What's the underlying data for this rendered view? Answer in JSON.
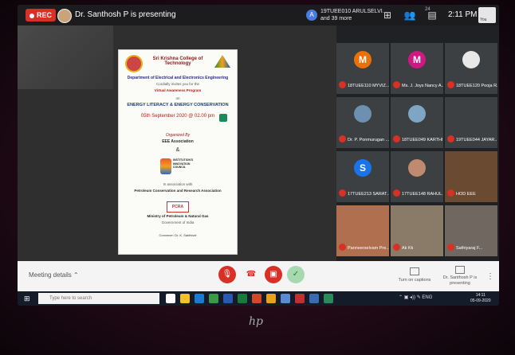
{
  "topbar": {
    "rec_label": "REC",
    "presenter_text": "Dr. Santhosh P is presenting",
    "join_initial": "A",
    "join_line1": "19TUEE010 ARULSELVI...",
    "join_line2": "and 39 more",
    "participant_count": "24",
    "time": "2:11 PM",
    "self_label": "You"
  },
  "presentation": {
    "college": "Sri Krishna College of Technology",
    "dept": "Department of Electrical and Electronics Engineering",
    "invite": "Cordially invites you for the",
    "program": "Virtual Awareness Program",
    "on": "on",
    "title": "ENERGY LITERACY & ENERGY CONSERVATION",
    "date": "05th September 2020 @ 02.00 pm",
    "org": "Organized By",
    "assoc": "EEE Association",
    "amp": "&",
    "iic": "INSTITUTION'S INNOVATION COUNCIL",
    "assoc_with": "In association with",
    "pcra_full": "Petroleum Conservation and Research Association",
    "pcra": "PCRA",
    "ministry": "Ministry of Petroleum & Natural Gas",
    "govt": "Government of India",
    "convener": "Convener: Dr. K. Sakthivel"
  },
  "participants": [
    {
      "initial": "M",
      "name": "18TUEE110 MYVIZ...",
      "color": "#e8710a"
    },
    {
      "initial": "M",
      "name": "Ms. J. Joys Nancy A...",
      "color": "#d01884"
    },
    {
      "initial": "",
      "name": "18TUEE120 Pooja R...",
      "color": "#e8e8e8"
    },
    {
      "initial": "",
      "name": "Dr. P. Ponmurugan ...",
      "color": "#6d8fb0"
    },
    {
      "initial": "",
      "name": "18TUEE049 KARTHI...",
      "color": "#7ea6c4"
    },
    {
      "initial": "",
      "name": "19TUEE044 JAYAR...",
      "color": "#3c4043"
    },
    {
      "initial": "S",
      "name": "17TUEE213 SARAT...",
      "color": "#1a73e8"
    },
    {
      "initial": "",
      "name": "17TUEE148 RAHUL...",
      "color": "#c08a70"
    },
    {
      "initial": "",
      "name": "HOD EEE",
      "color": "#6a4a30"
    },
    {
      "initial": "",
      "name": "Panneerselvam Pre...",
      "color": "#b07050"
    },
    {
      "initial": "",
      "name": "Ak Kk",
      "color": "#8a7a68"
    },
    {
      "initial": "",
      "name": "Sathiyaraj F...",
      "color": "#706860"
    }
  ],
  "controls": {
    "meeting_details": "Meeting details",
    "captions": "Turn on captions",
    "presenting": "Dr. Santhosh P is presenting"
  },
  "taskbar": {
    "search_placeholder": "Type here to search",
    "lang": "ENG",
    "time": "14:11",
    "date": "05-09-2020"
  },
  "bezel": {
    "logo": "hp"
  }
}
